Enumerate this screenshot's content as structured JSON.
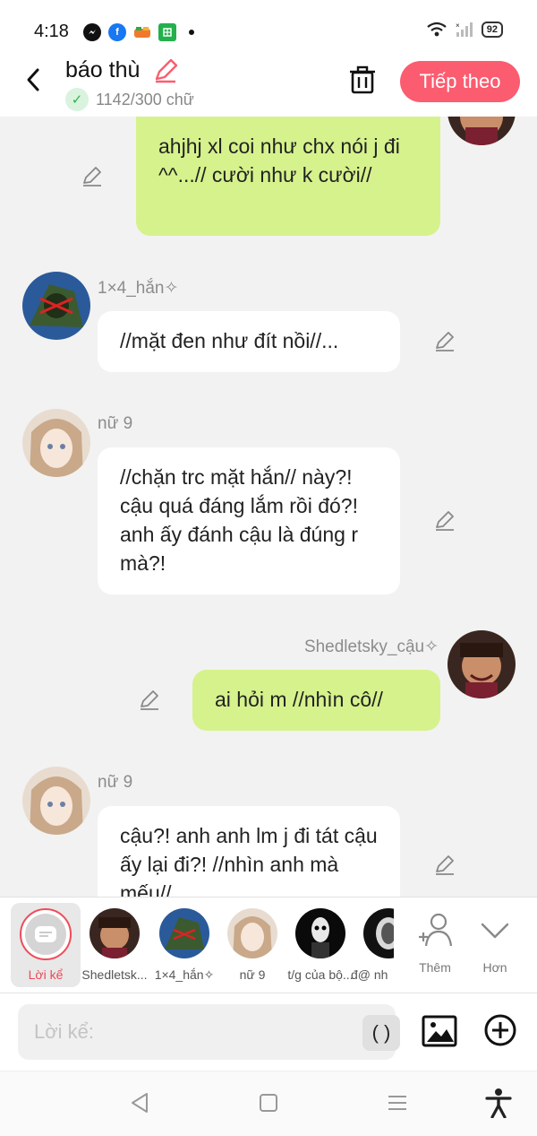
{
  "status_bar": {
    "time": "4:18",
    "battery": "92",
    "apps": [
      "messenger-icon",
      "facebook-icon",
      "game-icon",
      "sheet-icon"
    ]
  },
  "header": {
    "title": "báo thù",
    "word_count": "1142/300 chữ",
    "next_label": "Tiếp theo",
    "accent_color": "#fb5c70"
  },
  "messages": [
    {
      "sender": "",
      "text": "ahjhj xl coi như chx nói j đi ^^...// cười như k cười//",
      "mine": true
    },
    {
      "sender": "1×4_hắn✧",
      "text": "//mặt đen như đít nồi//...",
      "mine": false
    },
    {
      "sender": "nữ 9",
      "text": "//chặn trc mặt hắn// này?! cậu quá đáng lắm rồi đó?! anh ấy đánh cậu là đúng r mà?!",
      "mine": false
    },
    {
      "sender": "Shedletsky_cậu✧",
      "text": "ai hỏi m //nhìn cô//",
      "mine": true
    },
    {
      "sender": "nữ 9",
      "text": "cậu?! anh anh lm j đi tát cậu ấy lại đi?! //nhìn anh mà mếu//",
      "mine": false
    }
  ],
  "characters": {
    "narrator": "Lời kể",
    "items": [
      "Shedletsk...",
      "1×4_hắn✧",
      "nữ 9",
      "t/g của bộ...",
      "đ@ nh"
    ],
    "add_label": "Thêm",
    "more_label": "Hơn"
  },
  "composer": {
    "placeholder": "Lời kể:",
    "paren_label": "( )"
  }
}
